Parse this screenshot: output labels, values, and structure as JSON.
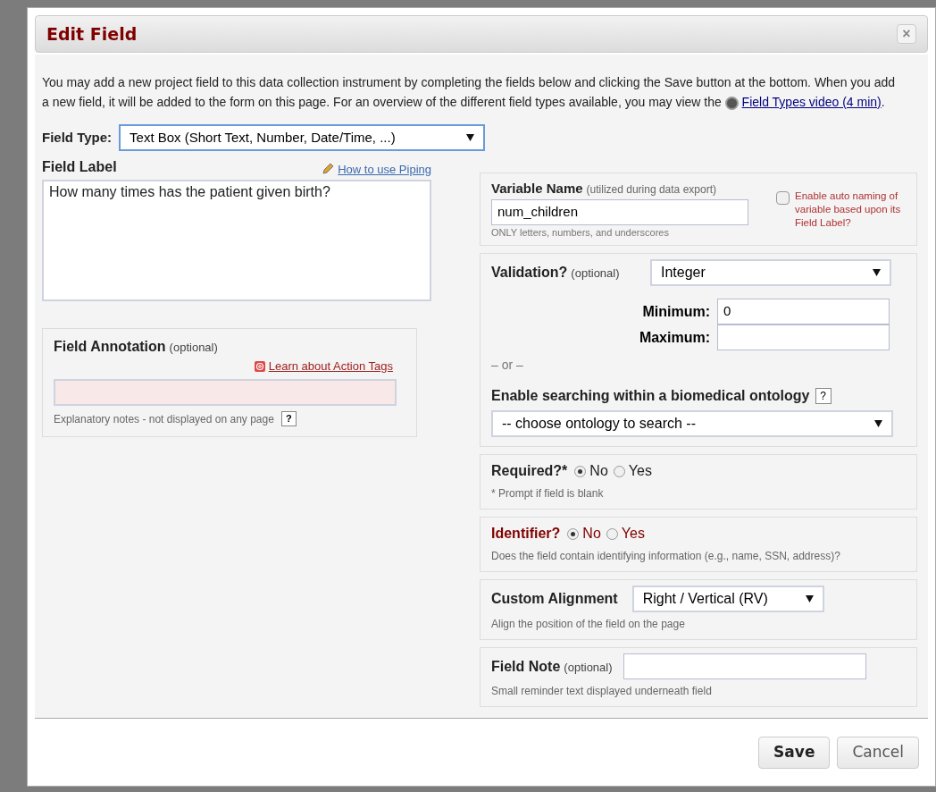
{
  "dialog": {
    "title": "Edit Field",
    "close": "×"
  },
  "intro": {
    "text": "You may add a new project field to this data collection instrument by completing the fields below and clicking the Save button at the bottom. When you add a new field, it will be added to the form on this page. For an overview of the different field types available, you may view the",
    "link": "Field Types video (4 min)",
    "after": "."
  },
  "field_type": {
    "label": "Field Type:",
    "value": "Text Box (Short Text, Number, Date/Time, ...)"
  },
  "field_label": {
    "label": "Field Label",
    "link": "How to use Piping",
    "value": "How many times has the patient given birth?"
  },
  "annotation": {
    "label": "Field Annotation",
    "optional": "(optional)",
    "link": "Learn about Action Tags",
    "hint": "Explanatory notes - not displayed on any page",
    "help": "?"
  },
  "variable": {
    "label": "Variable Name",
    "note": "(utilized during data export)",
    "value": "num_children",
    "hint": "ONLY letters, numbers, and underscores",
    "auto_naming": {
      "label": "Enable auto naming of variable based upon its Field Label?",
      "checked": false
    }
  },
  "validation": {
    "label": "Validation?",
    "optional": "(optional)",
    "value": "Integer",
    "minimum": {
      "label": "Minimum:",
      "value": "0"
    },
    "maximum": {
      "label": "Maximum:"
    },
    "or": "– or –",
    "ontology_label": "Enable searching within a biomedical ontology",
    "help": "?",
    "ontology_value": "-- choose ontology to search --"
  },
  "required": {
    "label": "Required?*",
    "options": [
      {
        "label": "No",
        "selected": true
      },
      {
        "label": "Yes",
        "selected": false
      }
    ],
    "hint": "* Prompt if field is blank"
  },
  "identifier": {
    "label": "Identifier?",
    "options": [
      {
        "label": "No",
        "selected": true
      },
      {
        "label": "Yes",
        "selected": false
      }
    ],
    "hint": "Does the field contain identifying information (e.g., name, SSN, address)?"
  },
  "alignment": {
    "label": "Custom Alignment",
    "value": "Right / Vertical (RV)",
    "hint": "Align the position of the field on the page"
  },
  "field_note": {
    "label": "Field Note",
    "optional": "(optional)",
    "hint": "Small reminder text displayed underneath field"
  },
  "buttons": [
    {
      "label": "Save",
      "kind": "primary"
    },
    {
      "label": "Cancel",
      "kind": "secondary"
    }
  ]
}
